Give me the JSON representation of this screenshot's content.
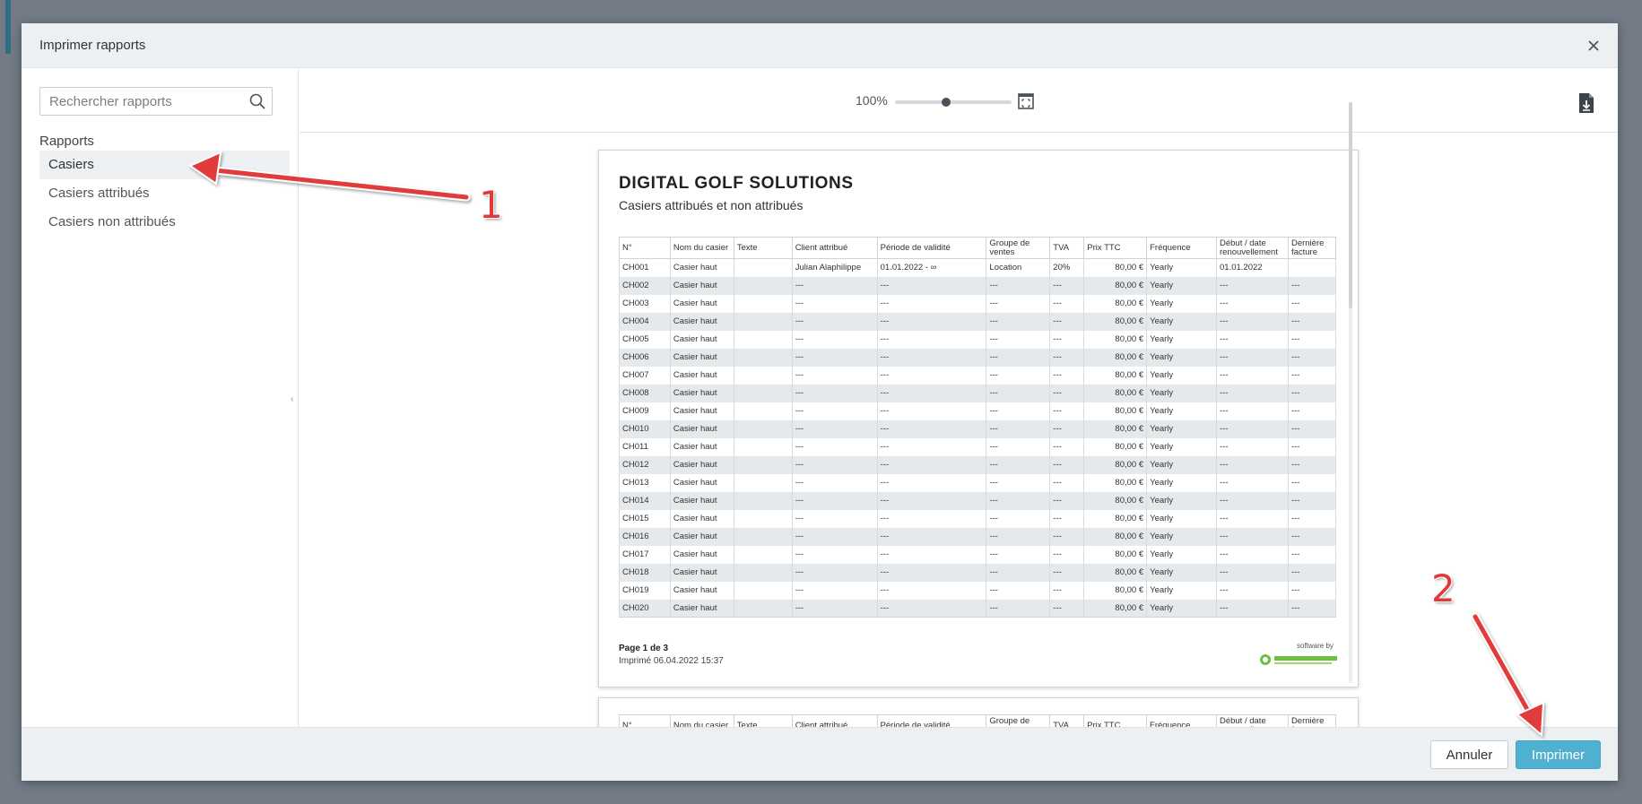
{
  "dialog": {
    "title": "Imprimer rapports"
  },
  "sidebar": {
    "search_placeholder": "Rechercher rapports",
    "section_label": "Rapports",
    "items": [
      {
        "label": "Casiers",
        "active": true
      },
      {
        "label": "Casiers attribués",
        "active": false
      },
      {
        "label": "Casiers non attribués",
        "active": false
      }
    ]
  },
  "toolbar": {
    "zoom_label": "100%",
    "zoom_level": 0.43
  },
  "document": {
    "title": "DIGITAL GOLF SOLUTIONS",
    "subtitle": "Casiers attribués et non attribués",
    "columns": [
      "N°",
      "Nom du casier",
      "Texte",
      "Client attribué",
      "Période de validité",
      "Groupe de ventes",
      "TVA",
      "Prix TTC",
      "Fréquence",
      "Début / date renouvellement",
      "Dernière facture"
    ],
    "rows": [
      [
        "CH001",
        "Casier haut",
        "",
        "Julian Alaphilippe",
        "01.01.2022 - ∞",
        "Location",
        "20%",
        "80,00 €",
        "Yearly",
        "01.01.2022",
        ""
      ],
      [
        "CH002",
        "Casier haut",
        "",
        "---",
        "---",
        "---",
        "---",
        "80,00 €",
        "Yearly",
        "---",
        "---"
      ],
      [
        "CH003",
        "Casier haut",
        "",
        "---",
        "---",
        "---",
        "---",
        "80,00 €",
        "Yearly",
        "---",
        "---"
      ],
      [
        "CH004",
        "Casier haut",
        "",
        "---",
        "---",
        "---",
        "---",
        "80,00 €",
        "Yearly",
        "---",
        "---"
      ],
      [
        "CH005",
        "Casier haut",
        "",
        "---",
        "---",
        "---",
        "---",
        "80,00 €",
        "Yearly",
        "---",
        "---"
      ],
      [
        "CH006",
        "Casier haut",
        "",
        "---",
        "---",
        "---",
        "---",
        "80,00 €",
        "Yearly",
        "---",
        "---"
      ],
      [
        "CH007",
        "Casier haut",
        "",
        "---",
        "---",
        "---",
        "---",
        "80,00 €",
        "Yearly",
        "---",
        "---"
      ],
      [
        "CH008",
        "Casier haut",
        "",
        "---",
        "---",
        "---",
        "---",
        "80,00 €",
        "Yearly",
        "---",
        "---"
      ],
      [
        "CH009",
        "Casier haut",
        "",
        "---",
        "---",
        "---",
        "---",
        "80,00 €",
        "Yearly",
        "---",
        "---"
      ],
      [
        "CH010",
        "Casier haut",
        "",
        "---",
        "---",
        "---",
        "---",
        "80,00 €",
        "Yearly",
        "---",
        "---"
      ],
      [
        "CH011",
        "Casier haut",
        "",
        "---",
        "---",
        "---",
        "---",
        "80,00 €",
        "Yearly",
        "---",
        "---"
      ],
      [
        "CH012",
        "Casier haut",
        "",
        "---",
        "---",
        "---",
        "---",
        "80,00 €",
        "Yearly",
        "---",
        "---"
      ],
      [
        "CH013",
        "Casier haut",
        "",
        "---",
        "---",
        "---",
        "---",
        "80,00 €",
        "Yearly",
        "---",
        "---"
      ],
      [
        "CH014",
        "Casier haut",
        "",
        "---",
        "---",
        "---",
        "---",
        "80,00 €",
        "Yearly",
        "---",
        "---"
      ],
      [
        "CH015",
        "Casier haut",
        "",
        "---",
        "---",
        "---",
        "---",
        "80,00 €",
        "Yearly",
        "---",
        "---"
      ],
      [
        "CH016",
        "Casier haut",
        "",
        "---",
        "---",
        "---",
        "---",
        "80,00 €",
        "Yearly",
        "---",
        "---"
      ],
      [
        "CH017",
        "Casier haut",
        "",
        "---",
        "---",
        "---",
        "---",
        "80,00 €",
        "Yearly",
        "---",
        "---"
      ],
      [
        "CH018",
        "Casier haut",
        "",
        "---",
        "---",
        "---",
        "---",
        "80,00 €",
        "Yearly",
        "---",
        "---"
      ],
      [
        "CH019",
        "Casier haut",
        "",
        "---",
        "---",
        "---",
        "---",
        "80,00 €",
        "Yearly",
        "---",
        "---"
      ],
      [
        "CH020",
        "Casier haut",
        "",
        "---",
        "---",
        "---",
        "---",
        "80,00 €",
        "Yearly",
        "---",
        "---"
      ]
    ],
    "page_label": "Page 1 de 3",
    "printed_label": "Imprimé 06.04.2022 15:37",
    "software_by": "software by",
    "brand_color": "#6cbf3f"
  },
  "footer": {
    "cancel_label": "Annuler",
    "print_label": "Imprimer",
    "print_color": "#4fb0cf"
  },
  "annotations": {
    "step1": "1",
    "step2": "2",
    "color": "#e23a3a"
  }
}
